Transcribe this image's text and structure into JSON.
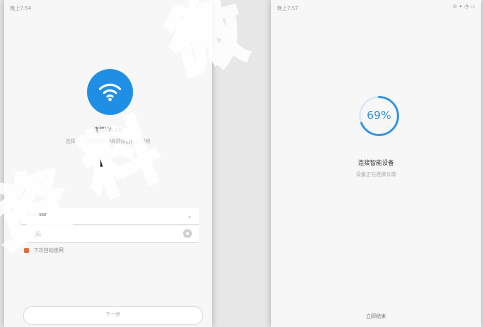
{
  "left_screen": {
    "status_time": "晚上7:54",
    "status_icons": "··· ✦ ▭",
    "title": "连接WLAN",
    "subtitle": "选择一个可用的WLAN供设备接入网络",
    "network_value": "Sidewar",
    "password_placeholder": "密码",
    "remember_label": "下次自动连网",
    "next_label": "下一步"
  },
  "right_screen": {
    "status_time": "晚上7:57",
    "status_icons": "⊘ ✦ ◔ ▭",
    "progress_value": 69,
    "progress_text": "69%",
    "title": "连接智能设备",
    "subtitle": "设备正在连接云端",
    "bottom_link": "立即结束"
  },
  "watermark": [
    "资",
    "料",
    "微"
  ],
  "colors": {
    "accent": "#1f8fe6",
    "progress_ring": "#2a8fe0",
    "checkbox": "#e06a3e"
  }
}
